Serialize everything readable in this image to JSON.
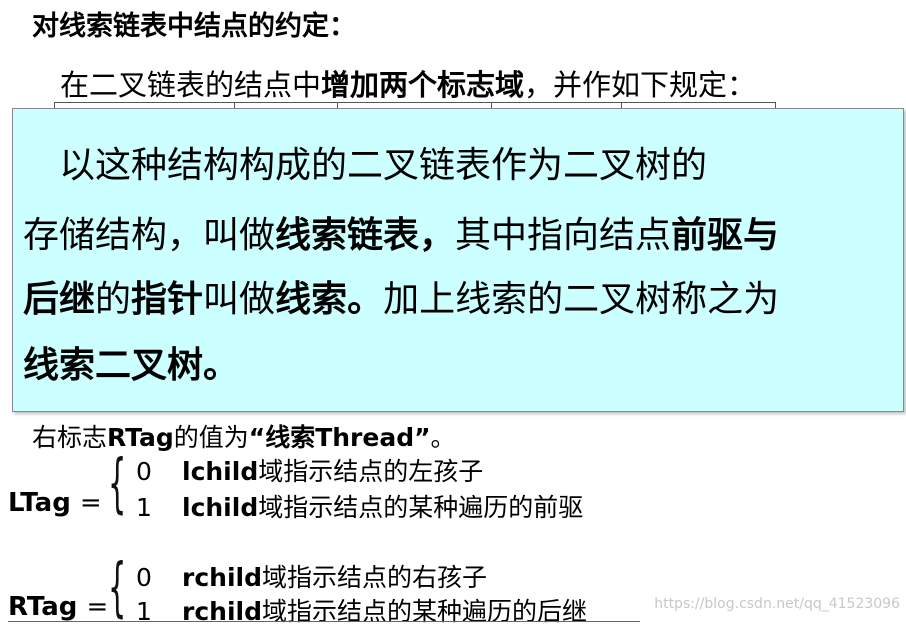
{
  "title": "对线索链表中结点的约定：",
  "intro": {
    "prefix": "在二叉链表的结点中",
    "bold": "增加两个标志域",
    "suffix": "，并作如下规定："
  },
  "callout": {
    "line1": "　以这种结构构成的二叉链表作为二叉树的",
    "line2_a": "存储结构，叫做",
    "line2_b": "线索链表，",
    "line2_c": "其中指向结点",
    "line2_d": "前驱与",
    "line3_a": "后继",
    "line3_b": "的",
    "line3_c": "指针",
    "line3_d": "叫做",
    "line3_e": "线索。",
    "line3_f": "加上线索的二叉树称之为",
    "line4": "线索二叉树。"
  },
  "rtag_note": {
    "a": "右标志",
    "b": "RTag",
    "c": "的值为",
    "d": "“线索Thread”",
    "e": "。"
  },
  "ltag": {
    "label": "LTag",
    "eq": "=",
    "rows": [
      {
        "num": "0",
        "field": "lchild",
        "desc": "域指示结点的左孩子"
      },
      {
        "num": "1",
        "field": "lchild",
        "desc": "域指示结点的某种遍历的前驱"
      }
    ]
  },
  "rtag": {
    "label": "RTag",
    "eq": "=",
    "rows": [
      {
        "num": "0",
        "field": "rchild",
        "desc": "域指示结点的右孩子"
      },
      {
        "num": "1",
        "field": "rchild",
        "desc": "域指示结点的某种遍历的后继"
      }
    ]
  },
  "watermark": "https://blog.csdn.net/qq_41523096"
}
